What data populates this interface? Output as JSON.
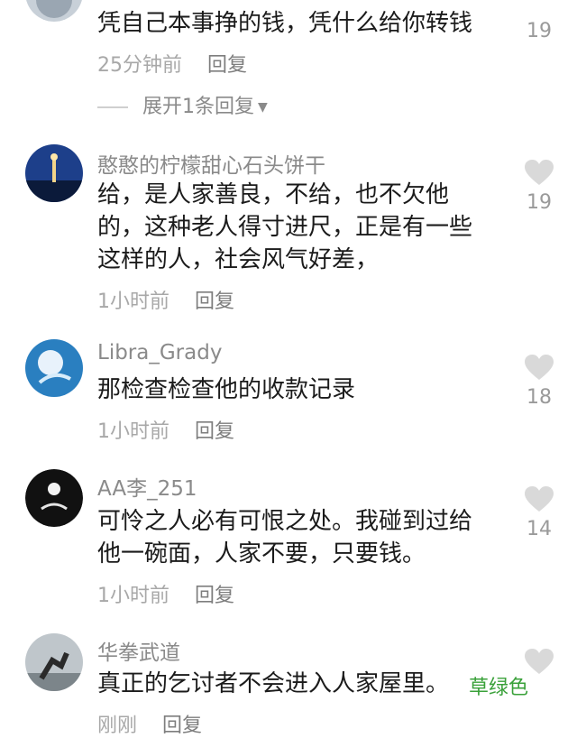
{
  "comments": [
    {
      "username": "",
      "text": "凭自己本事挣的钱，凭什么给你转钱",
      "time": "25分钟前",
      "reply": "回复",
      "likes": "19",
      "expand": "展开1条回复"
    },
    {
      "username": "憨憨的柠檬甜心石头饼干",
      "text": "给，是人家善良，不给，也不欠他的，这种老人得寸进尺，正是有一些这样的人，社会风气好差，",
      "time": "1小时前",
      "reply": "回复",
      "likes": "19"
    },
    {
      "username": "Libra_Grady",
      "text": "那检查检查他的收款记录",
      "time": "1小时前",
      "reply": "回复",
      "likes": "18"
    },
    {
      "username": "AA李_251",
      "text": "可怜之人必有可恨之处。我碰到过给他一碗面，人家不要，只要钱。",
      "time": "1小时前",
      "reply": "回复",
      "likes": "14"
    },
    {
      "username": "华拳武道",
      "text": "真正的乞讨者不会进入人家屋里。",
      "time": "刚刚",
      "reply": "回复",
      "likes": ""
    }
  ],
  "watermark": "草绿色",
  "icons": {
    "like": "heart-icon",
    "expand": "caret-down-icon"
  },
  "colors": {
    "text": "#1b1b1b",
    "meta": "#a8a8a8",
    "heart": "#d9d9d9",
    "watermark": "#3aa13a"
  }
}
